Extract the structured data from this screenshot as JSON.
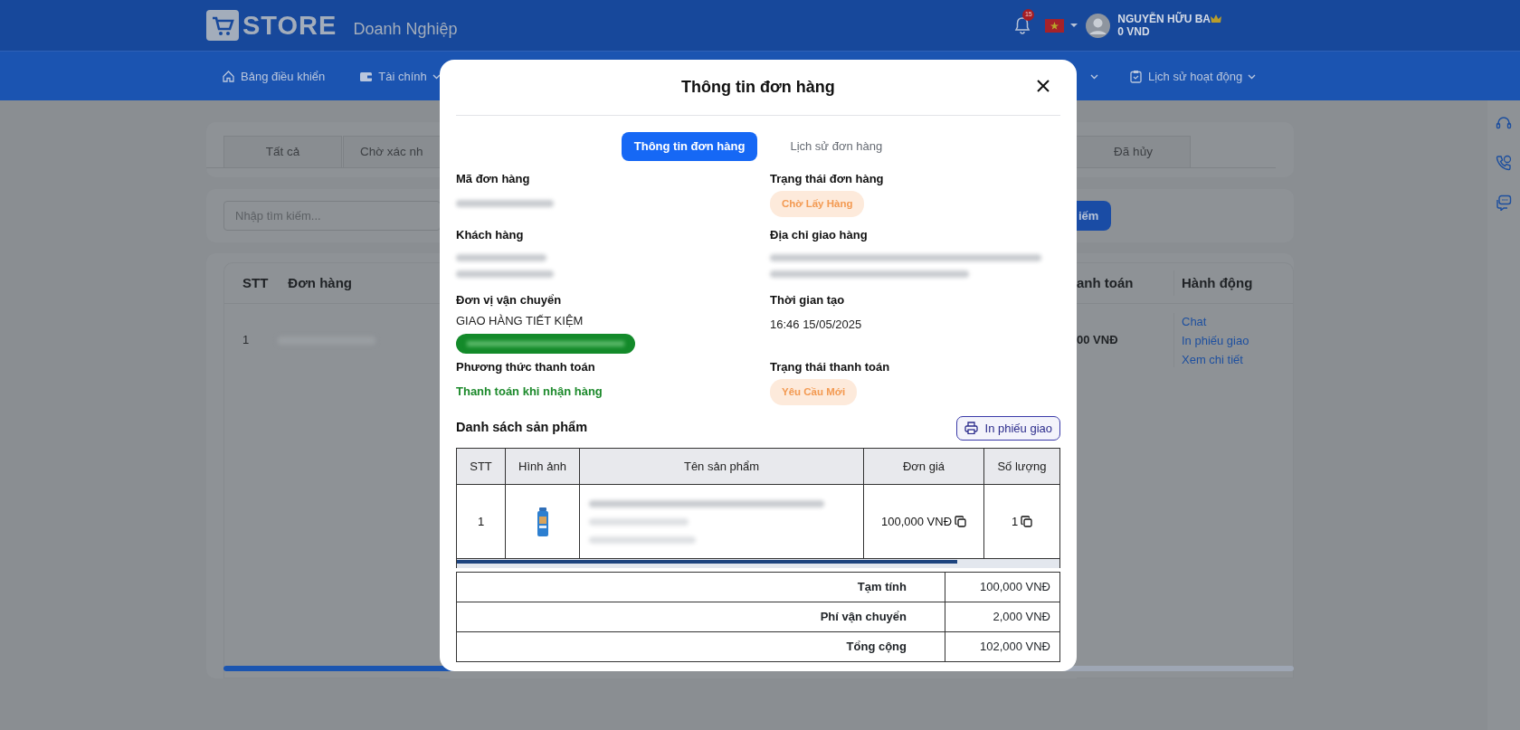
{
  "header": {
    "logo_text": "STORE",
    "subtitle": "Doanh Nghiệp",
    "notification_count": "15",
    "user_name": "NGUYỄN HỮU BA",
    "balance": "0 VND"
  },
  "nav": [
    {
      "kind": "home",
      "label": "Bảng điều khiển",
      "dropdown": false
    },
    {
      "kind": "wallet",
      "label": "Tài chính",
      "dropdown": true
    },
    {
      "kind": "none",
      "dropdown": true
    },
    {
      "kind": "clipboard",
      "label": "Lịch sử hoạt động",
      "dropdown": true
    }
  ],
  "status_tabs": [
    {
      "label": "Tất cả"
    },
    {
      "label": "Chờ xác nh"
    },
    {
      "label": "Đã hủy"
    }
  ],
  "search": {
    "placeholder": "Nhập tìm kiếm...",
    "button": "iếm"
  },
  "orders_table": {
    "columns": [
      "STT",
      "Đơn hàng",
      "anh toán",
      "Hành động"
    ],
    "rows": [
      {
        "stt": "1",
        "payment": "00 VNĐ",
        "actions": [
          "Chat",
          "In phiếu giao",
          "Xem chi tiết"
        ]
      }
    ]
  },
  "modal": {
    "title": "Thông tin đơn hàng",
    "tabs": [
      {
        "label": "Thông tin đơn hàng",
        "selected": true
      },
      {
        "label": "Lịch sử đơn hàng",
        "selected": false
      }
    ],
    "fields": [
      {
        "label": "Mã đơn hàng",
        "kind": "blurred"
      },
      {
        "label": "Trạng thái đơn hàng",
        "kind": "badge",
        "value": "Chờ Lấy Hàng"
      },
      {
        "label": "Khách hàng",
        "kind": "blurred_two_lines"
      },
      {
        "label": "Địa chỉ giao hàng",
        "kind": "blurred_two_lines"
      },
      {
        "label": "Đơn vị vận chuyển",
        "kind": "carrier",
        "value": "GIAO HÀNG TIẾT KIỆM"
      },
      {
        "label": "Thời gian tạo",
        "kind": "text",
        "value": "16:46 15/05/2025"
      },
      {
        "label": "Phương thức thanh toán",
        "kind": "highlight",
        "value": "Thanh toán khi nhận hàng"
      },
      {
        "label": "Trạng thái thanh toán",
        "kind": "badge",
        "value": "Yêu Cầu Mới"
      }
    ],
    "products_title": "Danh sách sản phẩm",
    "print_button": "In phiếu giao",
    "product_columns": [
      "STT",
      "Hình ảnh",
      "Tên sản phẩm",
      "Đơn giá",
      "Số lượng"
    ],
    "products": [
      {
        "stt": "1",
        "price": "100,000 VNĐ",
        "quantity": "1"
      }
    ],
    "summary": [
      {
        "label": "Tạm tính",
        "value": "100,000 VNĐ"
      },
      {
        "label": "Phí vận chuyển",
        "value": "2,000 VNĐ"
      },
      {
        "label": "Tổng cộng",
        "value": "102,000 VNĐ"
      }
    ]
  }
}
